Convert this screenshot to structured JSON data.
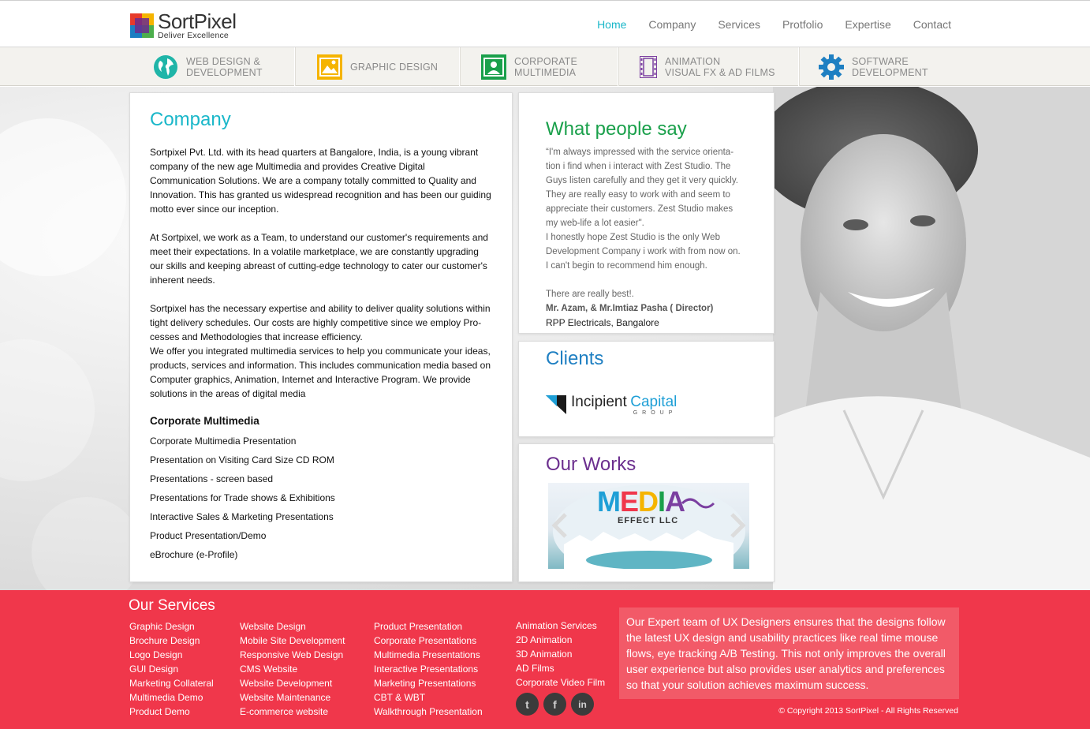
{
  "brand": {
    "name": "SortPixel",
    "tagline": "Deliver Excellence"
  },
  "nav": {
    "items": [
      "Home",
      "Company",
      "Services",
      "Protfolio",
      "Expertise",
      "Contact"
    ],
    "active": "Home"
  },
  "service_bar": [
    {
      "line1": "WEB DESIGN &",
      "line2": "DEVELOPMENT",
      "icon": "globe-icon"
    },
    {
      "line1": "GRAPHIC DESIGN",
      "line2": "",
      "icon": "image-icon"
    },
    {
      "line1": "CORPORATE",
      "line2": "MULTIMEDIA",
      "icon": "presenter-icon"
    },
    {
      "line1": "ANIMATION",
      "line2": "VISUAL FX & AD FILMS",
      "icon": "film-icon"
    },
    {
      "line1": "SOFTWARE",
      "line2": "DEVELOPMENT",
      "icon": "gear-icon"
    }
  ],
  "company": {
    "title": "Company",
    "paragraphs": [
      "Sortpixel Pvt. Ltd. with its head quarters at Bangalore, India, is a young vibrant company of the new age Multimedia and provides Creative Digital Communication Solutions. We are a company totally committed to Quality and Innovation. This has granted us widespread recognition and has been our guiding motto ever since our inception.",
      "At Sortpixel, we work as a Team, to understand our customer's requirements and meet their expectations. In a volatile marketplace, we are constantly upgrading our skills and keeping abreast of cutting-edge technology to cater our customer's inherent needs.",
      "Sortpixel has the necessary expertise and ability to deliver quality solutions within tight delivery schedules. Our costs are highly competitive since we employ Pro-cesses and Methodologies that increase efficiency.",
      "We offer you integrated multimedia services to help you communicate your ideas, products, services and information. This includes communication media based on Computer graphics, Animation, Internet and Interactive Program. We provide solutions in the areas of digital media"
    ],
    "cm_heading": "Corporate Multimedia",
    "cm_items": [
      "Corporate Multimedia Presentation",
      "Presentation on Visiting Card Size CD ROM",
      "Presentations - screen based",
      "Presentations for Trade shows & Exhibitions",
      "Interactive Sales & Marketing Presentations",
      "Product Presentation/Demo",
      "eBrochure (e-Profile)"
    ]
  },
  "testimonial": {
    "title": "What people say",
    "lines": [
      "“I'm always impressed with the service orienta-",
      "tion i find when i interact with Zest Studio. The",
      "Guys listen carefully and they get it very quickly.",
      "They are really easy to work with and seem to",
      "appreciate their customers. Zest Studio makes",
      "my web-life a lot easier\".",
      "I honestly hope Zest Studio is the only Web",
      "Development Company i work with from now on.",
      "I can't begin to recommend him enough.",
      "",
      "There are really best!."
    ],
    "signature": "Mr. Azam, &  Mr.Imtiaz Pasha  ( Director)",
    "company": "RPP Electricals, Bangalore"
  },
  "clients": {
    "title": "Clients",
    "logo_word1": "Incipient",
    "logo_word2": "Capital",
    "logo_sub": "GROUP"
  },
  "works": {
    "title": "Our Works",
    "logo_main": "MEDIA",
    "logo_sub": "EFFECT LLC"
  },
  "footer": {
    "title": "Our Services",
    "columns": [
      [
        "Graphic Design",
        "Brochure Design",
        "Logo Design",
        "GUI Design",
        "Marketing Collateral",
        "Multimedia Demo",
        "Product Demo"
      ],
      [
        "Website Design",
        "Mobile Site Development",
        "Responsive Web Design",
        "CMS Website",
        "Website Development",
        "Website Maintenance",
        "E-commerce website"
      ],
      [
        "Product Presentation",
        "Corporate Presentations",
        "Multimedia  Presentations",
        "Interactive  Presentations",
        "Marketing Presentations",
        "CBT & WBT",
        "Walkthrough Presentation"
      ],
      [
        "Animation Services",
        "2D Animation",
        "3D  Animation",
        "AD Films",
        "Corporate Video Film"
      ]
    ],
    "blurb": "Our Expert team of UX Designers ensures that the designs follow the  latest UX design and usability practices like real time mouse flows, eye tracking A/B Testing.  This not only improves the overall user experience but also provides user analytics and preferences so that your solution achieves maximum success.",
    "social": [
      {
        "name": "twitter-icon",
        "glyph": "t"
      },
      {
        "name": "facebook-icon",
        "glyph": "f"
      },
      {
        "name": "linkedin-icon",
        "glyph": "in"
      }
    ],
    "copyright": "© Copyright 2013 SortPixel - All Rights Reserved"
  },
  "colors": {
    "accent": "#1ab7c9",
    "footer": "#f0374b",
    "testimonial_title": "#1aa04b",
    "clients_title": "#1e7fc2",
    "works_title": "#6b2e8e"
  }
}
